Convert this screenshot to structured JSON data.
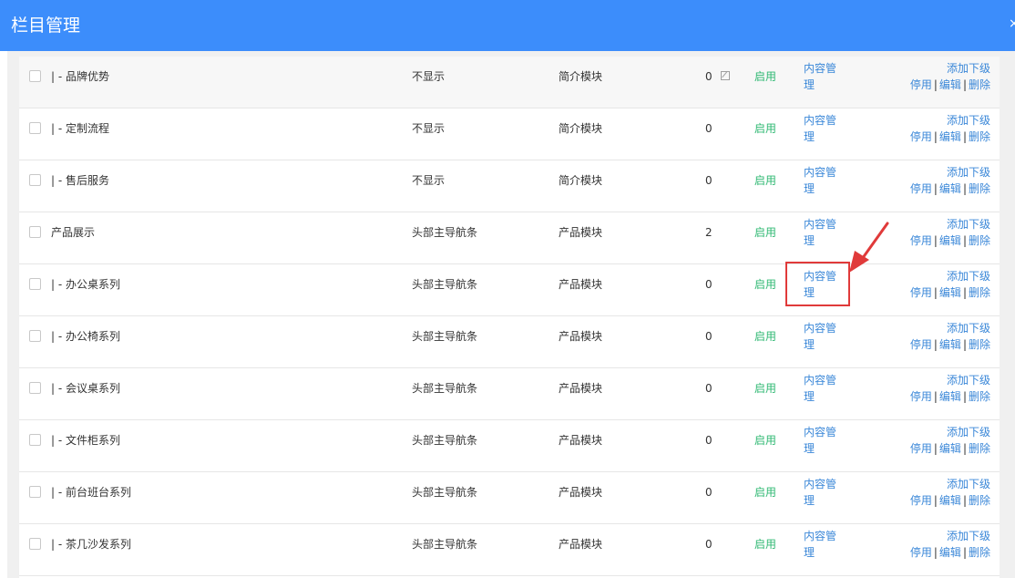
{
  "header": {
    "title": "栏目管理",
    "close_icon": "close-icon"
  },
  "columns": [
    "name",
    "position",
    "module",
    "count",
    "status",
    "content",
    "actions"
  ],
  "rows": [
    {
      "name": "| - 品牌优势",
      "position": "不显示",
      "module": "简介模块",
      "count": "0",
      "status": "启用",
      "content_link": "内容管理",
      "add_child": "添加下级",
      "disable": "停用",
      "edit": "编辑",
      "delete": "删除",
      "has_edit_icon": true
    },
    {
      "name": "| - 定制流程",
      "position": "不显示",
      "module": "简介模块",
      "count": "0",
      "status": "启用",
      "content_link": "内容管理",
      "add_child": "添加下级",
      "disable": "停用",
      "edit": "编辑",
      "delete": "删除"
    },
    {
      "name": "| - 售后服务",
      "position": "不显示",
      "module": "简介模块",
      "count": "0",
      "status": "启用",
      "content_link": "内容管理",
      "add_child": "添加下级",
      "disable": "停用",
      "edit": "编辑",
      "delete": "删除"
    },
    {
      "name": "产品展示",
      "position": "头部主导航条",
      "module": "产品模块",
      "count": "2",
      "status": "启用",
      "content_link": "内容管理",
      "add_child": "添加下级",
      "disable": "停用",
      "edit": "编辑",
      "delete": "删除"
    },
    {
      "name": "| - 办公桌系列",
      "position": "头部主导航条",
      "module": "产品模块",
      "count": "0",
      "status": "启用",
      "content_link": "内容管理",
      "add_child": "添加下级",
      "disable": "停用",
      "edit": "编辑",
      "delete": "删除",
      "highlighted": true
    },
    {
      "name": "| - 办公椅系列",
      "position": "头部主导航条",
      "module": "产品模块",
      "count": "0",
      "status": "启用",
      "content_link": "内容管理",
      "add_child": "添加下级",
      "disable": "停用",
      "edit": "编辑",
      "delete": "删除"
    },
    {
      "name": "| - 会议桌系列",
      "position": "头部主导航条",
      "module": "产品模块",
      "count": "0",
      "status": "启用",
      "content_link": "内容管理",
      "add_child": "添加下级",
      "disable": "停用",
      "edit": "编辑",
      "delete": "删除"
    },
    {
      "name": "| - 文件柜系列",
      "position": "头部主导航条",
      "module": "产品模块",
      "count": "0",
      "status": "启用",
      "content_link": "内容管理",
      "add_child": "添加下级",
      "disable": "停用",
      "edit": "编辑",
      "delete": "删除"
    },
    {
      "name": "| - 前台班台系列",
      "position": "头部主导航条",
      "module": "产品模块",
      "count": "0",
      "status": "启用",
      "content_link": "内容管理",
      "add_child": "添加下级",
      "disable": "停用",
      "edit": "编辑",
      "delete": "删除"
    },
    {
      "name": "| - 茶几沙发系列",
      "position": "头部主导航条",
      "module": "产品模块",
      "count": "0",
      "status": "启用",
      "content_link": "内容管理",
      "add_child": "添加下级",
      "disable": "停用",
      "edit": "编辑",
      "delete": "删除"
    }
  ],
  "colors": {
    "header_bg": "#3c8dfb",
    "link": "#3a87d8",
    "status_enabled": "#2eb872",
    "annotation": "#e03a3a"
  },
  "annotation": {
    "shape": "red-box-with-arrow"
  }
}
